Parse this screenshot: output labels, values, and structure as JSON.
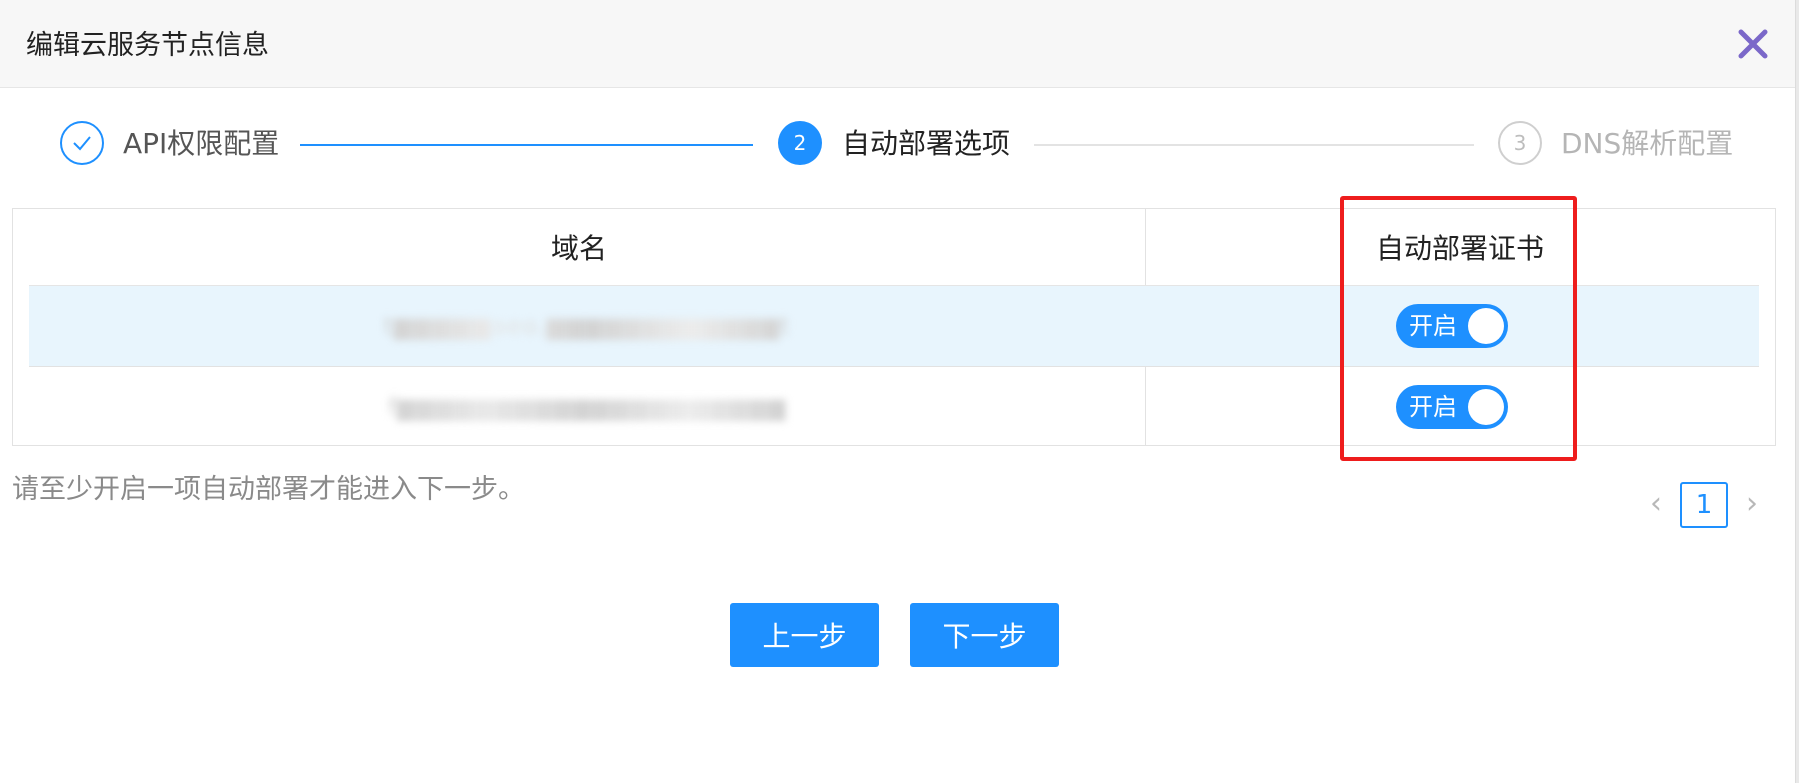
{
  "dialog": {
    "title": "编辑云服务节点信息"
  },
  "steps": [
    {
      "index": "1",
      "title": "API权限配置",
      "status": "done"
    },
    {
      "index": "2",
      "title": "自动部署选项",
      "status": "active"
    },
    {
      "index": "3",
      "title": "DNS解析配置",
      "status": "wait"
    }
  ],
  "table": {
    "columns": [
      "域名",
      "自动部署证书"
    ],
    "rows": [
      {
        "domain": "t▆▆▆▆▆aeo.▆▆▆▆▆▆▆▆▆▆▆▆t",
        "auto_deploy_label": "开启",
        "auto_deploy_on": true
      },
      {
        "domain": "f▆▆▆▆▆▆▆▆▆▆▆▆▆▆▆▆▆▆▆▆",
        "auto_deploy_label": "开启",
        "auto_deploy_on": true
      }
    ]
  },
  "hint": "请至少开启一项自动部署才能进入下一步。",
  "pagination": {
    "current_page": "1",
    "prev_icon": "chevron-left-icon",
    "next_icon": "chevron-right-icon"
  },
  "buttons": {
    "prev_label": "上一步",
    "next_label": "下一步"
  },
  "colors": {
    "primary": "#1e90ff",
    "highlight_border": "#ee1d1d",
    "selected_row_bg": "#e8f5fd",
    "close_icon": "#7b68c9"
  }
}
